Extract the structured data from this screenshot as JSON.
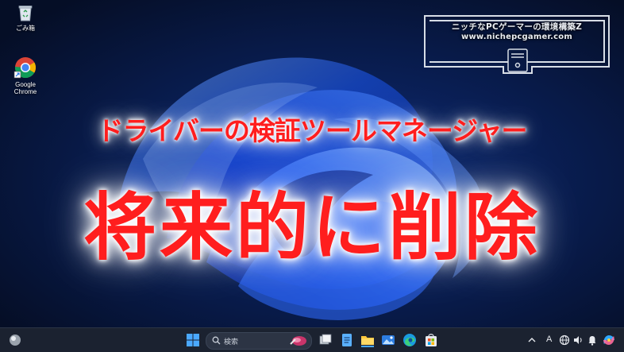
{
  "desktop": {
    "icons": [
      {
        "label": "ごみ箱",
        "icon": "recycle-bin-icon"
      },
      {
        "label": "Google Chrome",
        "icon": "chrome-icon"
      }
    ]
  },
  "brand": {
    "title": "ニッチなPCゲーマーの環境構築Z",
    "url": "www.nichepcgamer.com",
    "icon": "pc-tower-icon"
  },
  "headline": {
    "sub": "ドライバーの検証ツールマネージャー",
    "main": "将来的に削除",
    "color": "#ff1e1e"
  },
  "taskbar": {
    "search_placeholder": "検索",
    "items": [
      "widgets-icon",
      "start-icon",
      "search-icon",
      "task-view-icon",
      "notepad-icon",
      "file-explorer-icon",
      "photos-icon",
      "edge-icon",
      "store-icon"
    ],
    "tray": {
      "chevron": "^",
      "ime": "A",
      "icons": [
        "network-icon",
        "volume-icon",
        "notification-icon",
        "copilot-icon"
      ]
    }
  },
  "colors": {
    "wallpaper_dark": "#071330",
    "wallpaper_bloom": "#1a5cff",
    "taskbar": "#1b2230"
  }
}
